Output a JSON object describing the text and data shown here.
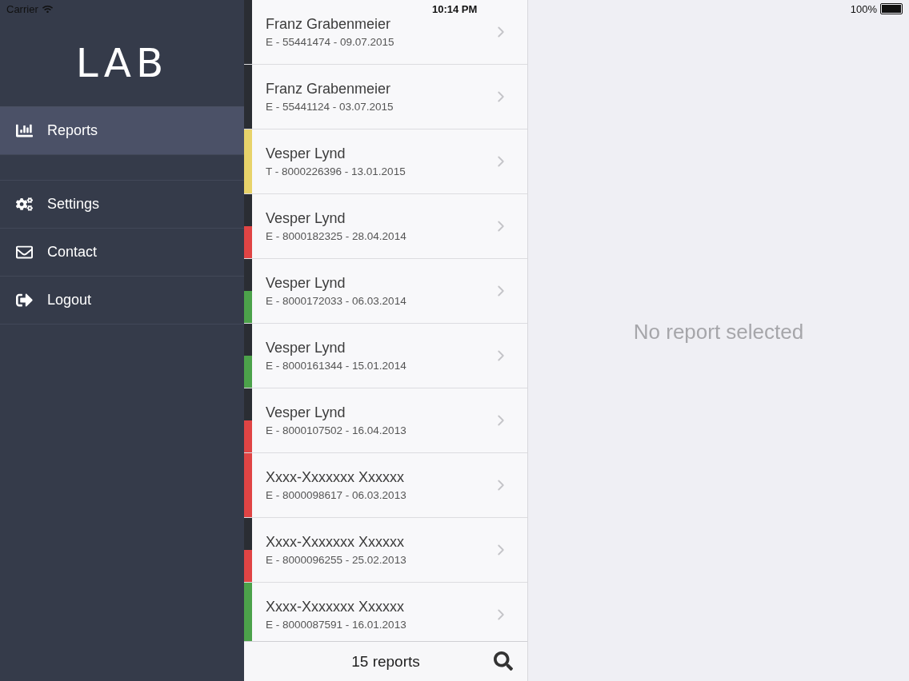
{
  "status_bar": {
    "carrier": "Carrier",
    "time": "10:14 PM",
    "battery": "100%"
  },
  "sidebar": {
    "logo": "LAB",
    "items": [
      {
        "kind": "reports",
        "label": "Reports",
        "selected": true
      },
      {
        "kind": "settings",
        "label": "Settings",
        "selected": false
      },
      {
        "kind": "contact",
        "label": "Contact",
        "selected": false
      },
      {
        "kind": "logout",
        "label": "Logout",
        "selected": false
      }
    ]
  },
  "reports": [
    {
      "name": "Franz Grabenmeier",
      "detail": "E - 55441474 - 09.07.2015"
    },
    {
      "name": "Franz Grabenmeier",
      "detail": "E - 55441124 - 03.07.2015"
    },
    {
      "name": "Vesper Lynd",
      "detail": "T - 8000226396 - 13.01.2015",
      "color": "#e8d36a",
      "level": 1
    },
    {
      "name": "Vesper Lynd",
      "detail": "E - 8000182325 - 28.04.2014",
      "color": "#e04444",
      "level": 0.5
    },
    {
      "name": "Vesper Lynd",
      "detail": "E - 8000172033 - 06.03.2014",
      "color": "#4ca24a",
      "level": 0.5
    },
    {
      "name": "Vesper Lynd",
      "detail": "E - 8000161344 - 15.01.2014",
      "color": "#4ca24a",
      "level": 0.5
    },
    {
      "name": "Vesper Lynd",
      "detail": "E - 8000107502 - 16.04.2013",
      "color": "#e04444",
      "level": 0.5
    },
    {
      "name": "Xxxx-Xxxxxxx Xxxxxx",
      "detail": "E - 8000098617 - 06.03.2013",
      "color": "#e04444",
      "level": 1
    },
    {
      "name": "Xxxx-Xxxxxxx Xxxxxx",
      "detail": "E - 8000096255 - 25.02.2013",
      "color": "#e04444",
      "level": 0.5
    },
    {
      "name": "Xxxx-Xxxxxxx Xxxxxx",
      "detail": "E - 8000087591 - 16.01.2013",
      "color": "#4ca24a",
      "level": 1
    }
  ],
  "footer": {
    "count": "15 reports"
  },
  "detail": {
    "empty_message": "No report selected"
  }
}
